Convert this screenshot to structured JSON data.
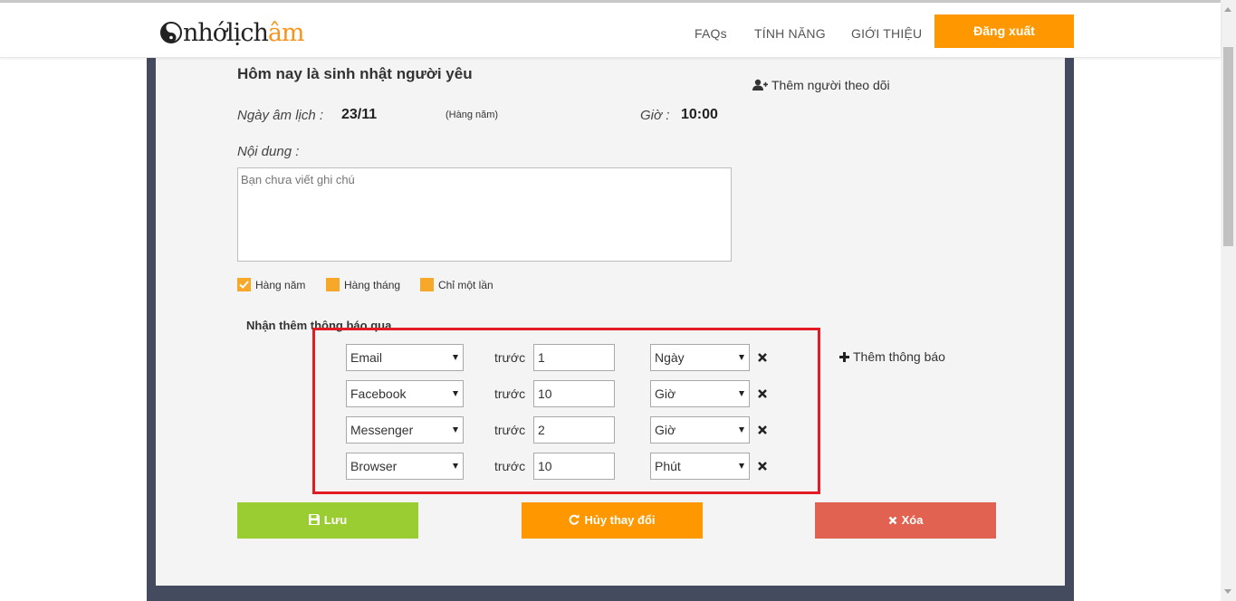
{
  "header": {
    "logo": {
      "part1": "nhớ",
      "part2": "lịch",
      "part3": "âm"
    },
    "nav": [
      "FAQs",
      "TÍNH NĂNG",
      "GIỚI THIỆU"
    ],
    "logout_label": "Đăng xuất"
  },
  "event": {
    "title": "Hôm nay là sinh nhật người yêu",
    "lunar_label": "Ngày âm lịch :",
    "lunar_value": "23/11",
    "repeat_note": "(Hàng năm)",
    "time_label": "Giờ :",
    "time_value": "10:00",
    "content_label": "Nội dung :",
    "content_placeholder": "Bạn chưa viết ghi chú",
    "follow_label": "Thêm người theo dõi"
  },
  "repeat_options": [
    {
      "label": "Hàng năm",
      "checked": true
    },
    {
      "label": "Hàng tháng",
      "checked": false
    },
    {
      "label": "Chỉ một lần",
      "checked": false
    }
  ],
  "notifications": {
    "title": "Nhận thêm thông báo qua",
    "before_label": "trước",
    "add_label": "Thêm thông báo",
    "rows": [
      {
        "channel": "Email",
        "amount": "1",
        "unit": "Ngày"
      },
      {
        "channel": "Facebook",
        "amount": "10",
        "unit": "Giờ"
      },
      {
        "channel": "Messenger",
        "amount": "2",
        "unit": "Giờ"
      },
      {
        "channel": "Browser",
        "amount": "10",
        "unit": "Phút"
      }
    ]
  },
  "actions": {
    "save_label": "Lưu",
    "cancel_label": "Hủy thay đổi",
    "delete_label": "Xóa"
  },
  "colors": {
    "accent": "#ff9800",
    "checkbox": "#f7a829",
    "save": "#9acd32",
    "cancel": "#ff9800",
    "delete": "#e16250",
    "highlight": "#e21b25",
    "frame": "#454b5f"
  }
}
